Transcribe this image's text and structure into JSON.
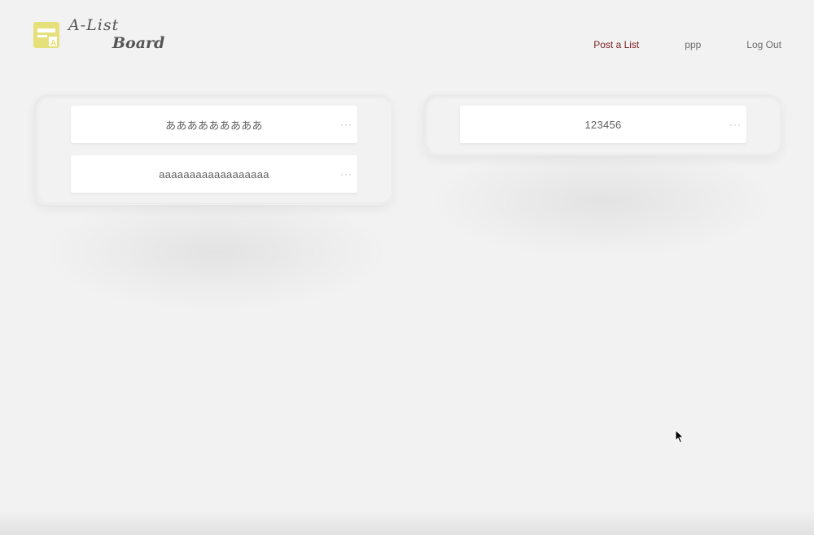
{
  "logo": {
    "line1": "A-List",
    "line2": "Board",
    "icon": "list-card-icon",
    "icon_color": "#e6e07a"
  },
  "nav": {
    "post_list": "Post a List",
    "user": "ppp",
    "logout": "Log Out"
  },
  "columns": [
    {
      "cards": [
        {
          "title": "あああああああああ",
          "menu": "···"
        },
        {
          "title": "aaaaaaaaaaaaaaaaaa",
          "menu": "···"
        }
      ]
    },
    {
      "cards": [
        {
          "title": "123456",
          "menu": "···"
        }
      ]
    }
  ],
  "colors": {
    "background": "#f3f2f3",
    "primary_link": "#7a1e1e",
    "text": "#5f5f5f"
  }
}
